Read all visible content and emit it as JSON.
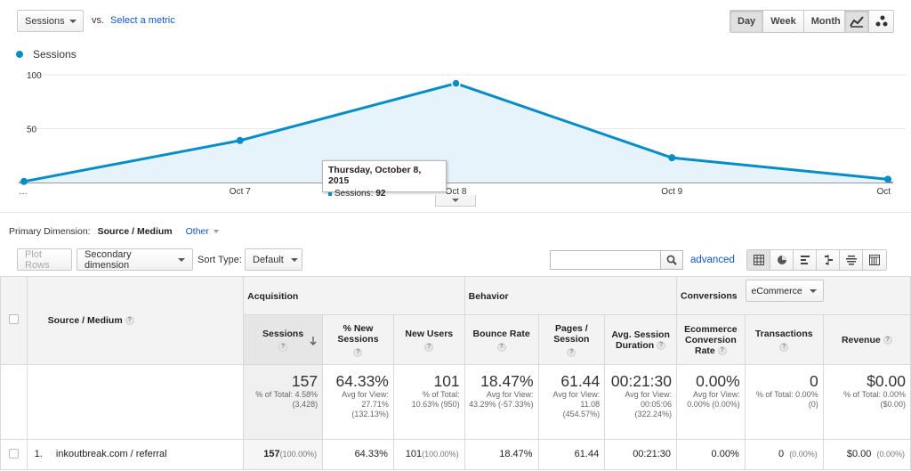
{
  "header": {
    "metric_select": "Sessions",
    "vs_label": "vs.",
    "select_metric_link": "Select a metric",
    "periods": [
      "Day",
      "Week",
      "Month"
    ],
    "active_period": "Day"
  },
  "legend": {
    "label": "Sessions",
    "color": "#058dc7"
  },
  "chart_data": {
    "type": "area",
    "x": [
      "…",
      "Oct 7",
      "Oct 8",
      "Oct 9",
      "Oct"
    ],
    "series": [
      {
        "name": "Sessions",
        "values": [
          1,
          39,
          92,
          23,
          3
        ],
        "color": "#058dc7"
      }
    ],
    "y_ticks": [
      "100",
      "50"
    ],
    "ylim": [
      0,
      100
    ],
    "grid": true
  },
  "tooltip": {
    "title": "Thursday, October 8, 2015",
    "label": "Sessions:",
    "value": "92"
  },
  "dimension": {
    "label": "Primary Dimension:",
    "active": "Source / Medium",
    "other": "Other"
  },
  "toolbar": {
    "plot_rows": "Plot Rows",
    "secondary_dimension": "Secondary dimension",
    "sort_label": "Sort Type:",
    "sort_value": "Default",
    "search_value": "",
    "advanced": "advanced"
  },
  "table": {
    "groups": {
      "acquisition": "Acquisition",
      "behavior": "Behavior",
      "conversions": "Conversions",
      "conversions_select": "eCommerce"
    },
    "dim_header": "Source / Medium",
    "headers": {
      "sessions": "Sessions",
      "new_sessions": "% New Sessions",
      "new_users": "New Users",
      "bounce_rate": "Bounce Rate",
      "pages_session": "Pages / Session",
      "avg_session": "Avg. Session Duration",
      "ecom_rate": "Ecommerce Conversion Rate",
      "transactions": "Transactions",
      "revenue": "Revenue"
    },
    "totals": {
      "sessions": {
        "big": "157",
        "sub": "% of Total: 4.58% (3,428)"
      },
      "new_sessions": {
        "big": "64.33%",
        "sub": "Avg for View: 27.71% (132.13%)"
      },
      "new_users": {
        "big": "101",
        "sub": "% of Total: 10.63% (950)"
      },
      "bounce_rate": {
        "big": "18.47%",
        "sub": "Avg for View: 43.29% (-57.33%)"
      },
      "pages_session": {
        "big": "61.44",
        "sub": "Avg for View: 11.08 (454.57%)"
      },
      "avg_session": {
        "big": "00:21:30",
        "sub": "Avg for View: 00:05:06 (322.24%)"
      },
      "ecom_rate": {
        "big": "0.00%",
        "sub": "Avg for View: 0.00% (0.00%)"
      },
      "transactions": {
        "big": "0",
        "sub": "% of Total: 0.00% (0)"
      },
      "revenue": {
        "big": "$0.00",
        "sub": "% of Total: 0.00% ($0.00)"
      }
    },
    "rows": [
      {
        "index": "1.",
        "source": "inkoutbreak.com / referral",
        "sessions": "157",
        "sessions_pct": "(100.00%)",
        "new_sessions": "64.33%",
        "new_users": "101",
        "new_users_pct": "(100.00%)",
        "bounce_rate": "18.47%",
        "pages_session": "61.44",
        "avg_session": "00:21:30",
        "ecom_rate": "0.00%",
        "transactions": "0",
        "transactions_pct": "(0.00%)",
        "revenue": "$0.00",
        "revenue_pct": "(0.00%)"
      }
    ]
  }
}
